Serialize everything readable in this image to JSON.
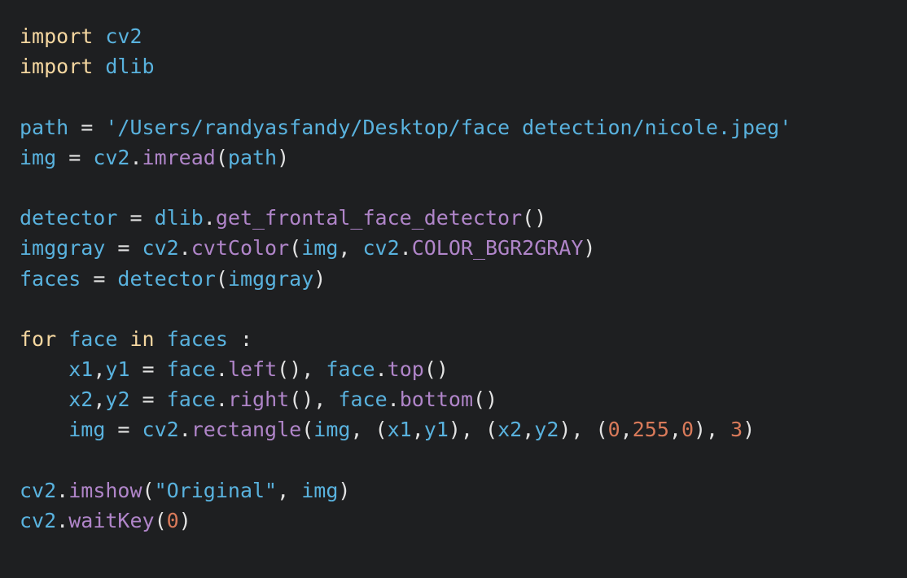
{
  "theme": {
    "background": "#1e1f21",
    "keyword": "#f5d7a0",
    "identifier": "#59b2de",
    "function": "#b085c9",
    "operator": "#e3e3e3",
    "number": "#d97a5a"
  },
  "code": {
    "lines": [
      [
        [
          "kw",
          "import"
        ],
        [
          "op",
          " "
        ],
        [
          "id",
          "cv2"
        ]
      ],
      [
        [
          "kw",
          "import"
        ],
        [
          "op",
          " "
        ],
        [
          "id",
          "dlib"
        ]
      ],
      [],
      [
        [
          "id",
          "path"
        ],
        [
          "op",
          " = "
        ],
        [
          "str",
          "'/Users/randyasfandy/Desktop/face detection/nicole.jpeg'"
        ]
      ],
      [
        [
          "id",
          "img"
        ],
        [
          "op",
          " = "
        ],
        [
          "id",
          "cv2"
        ],
        [
          "op",
          "."
        ],
        [
          "fn",
          "imread"
        ],
        [
          "op",
          "("
        ],
        [
          "id",
          "path"
        ],
        [
          "op",
          ")"
        ]
      ],
      [],
      [
        [
          "id",
          "detector"
        ],
        [
          "op",
          " = "
        ],
        [
          "id",
          "dlib"
        ],
        [
          "op",
          "."
        ],
        [
          "fn",
          "get_frontal_face_detector"
        ],
        [
          "op",
          "()"
        ]
      ],
      [
        [
          "id",
          "imggray"
        ],
        [
          "op",
          " = "
        ],
        [
          "id",
          "cv2"
        ],
        [
          "op",
          "."
        ],
        [
          "fn",
          "cvtColor"
        ],
        [
          "op",
          "("
        ],
        [
          "id",
          "img"
        ],
        [
          "op",
          ", "
        ],
        [
          "id",
          "cv2"
        ],
        [
          "op",
          "."
        ],
        [
          "fn",
          "COLOR_BGR2GRAY"
        ],
        [
          "op",
          ")"
        ]
      ],
      [
        [
          "id",
          "faces"
        ],
        [
          "op",
          " = "
        ],
        [
          "id",
          "detector"
        ],
        [
          "op",
          "("
        ],
        [
          "id",
          "imggray"
        ],
        [
          "op",
          ")"
        ]
      ],
      [],
      [
        [
          "kw",
          "for"
        ],
        [
          "op",
          " "
        ],
        [
          "id",
          "face"
        ],
        [
          "op",
          " "
        ],
        [
          "kw",
          "in"
        ],
        [
          "op",
          " "
        ],
        [
          "id",
          "faces"
        ],
        [
          "op",
          " :"
        ]
      ],
      [
        [
          "op",
          "    "
        ],
        [
          "id",
          "x1"
        ],
        [
          "op",
          ","
        ],
        [
          "id",
          "y1"
        ],
        [
          "op",
          " = "
        ],
        [
          "id",
          "face"
        ],
        [
          "op",
          "."
        ],
        [
          "fn",
          "left"
        ],
        [
          "op",
          "(), "
        ],
        [
          "id",
          "face"
        ],
        [
          "op",
          "."
        ],
        [
          "fn",
          "top"
        ],
        [
          "op",
          "()"
        ]
      ],
      [
        [
          "op",
          "    "
        ],
        [
          "id",
          "x2"
        ],
        [
          "op",
          ","
        ],
        [
          "id",
          "y2"
        ],
        [
          "op",
          " = "
        ],
        [
          "id",
          "face"
        ],
        [
          "op",
          "."
        ],
        [
          "fn",
          "right"
        ],
        [
          "op",
          "(), "
        ],
        [
          "id",
          "face"
        ],
        [
          "op",
          "."
        ],
        [
          "fn",
          "bottom"
        ],
        [
          "op",
          "()"
        ]
      ],
      [
        [
          "op",
          "    "
        ],
        [
          "id",
          "img"
        ],
        [
          "op",
          " = "
        ],
        [
          "id",
          "cv2"
        ],
        [
          "op",
          "."
        ],
        [
          "fn",
          "rectangle"
        ],
        [
          "op",
          "("
        ],
        [
          "id",
          "img"
        ],
        [
          "op",
          ", ("
        ],
        [
          "id",
          "x1"
        ],
        [
          "op",
          ","
        ],
        [
          "id",
          "y1"
        ],
        [
          "op",
          "), ("
        ],
        [
          "id",
          "x2"
        ],
        [
          "op",
          ","
        ],
        [
          "id",
          "y2"
        ],
        [
          "op",
          "), ("
        ],
        [
          "num",
          "0"
        ],
        [
          "op",
          ","
        ],
        [
          "num",
          "255"
        ],
        [
          "op",
          ","
        ],
        [
          "num",
          "0"
        ],
        [
          "op",
          "), "
        ],
        [
          "num",
          "3"
        ],
        [
          "op",
          ")"
        ]
      ],
      [],
      [
        [
          "id",
          "cv2"
        ],
        [
          "op",
          "."
        ],
        [
          "fn",
          "imshow"
        ],
        [
          "op",
          "("
        ],
        [
          "str",
          "\"Original\""
        ],
        [
          "op",
          ", "
        ],
        [
          "id",
          "img"
        ],
        [
          "op",
          ")"
        ]
      ],
      [
        [
          "id",
          "cv2"
        ],
        [
          "op",
          "."
        ],
        [
          "fn",
          "waitKey"
        ],
        [
          "op",
          "("
        ],
        [
          "num",
          "0"
        ],
        [
          "op",
          ")"
        ]
      ]
    ]
  }
}
